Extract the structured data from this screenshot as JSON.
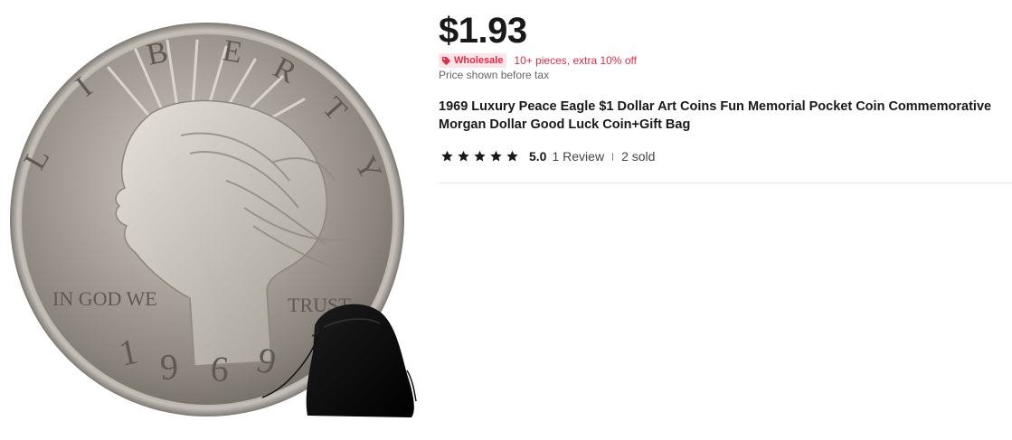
{
  "product": {
    "image": {
      "coin_lettering_top": "LIBERTY",
      "coin_motto_left": "IN GOD WE",
      "coin_motto_right": "TRUST",
      "coin_year": "1969"
    },
    "price": "$1.93",
    "wholesale": {
      "badge_icon": "tag-icon",
      "badge_label": "Wholesale",
      "deal_text": "10+ pieces, extra 10% off"
    },
    "price_note": "Price shown before tax",
    "title": "1969 Luxury Peace Eagle $1 Dollar Art Coins Fun Memorial Pocket Coin Commemorative Morgan Dollar Good Luck Coin+Gift Bag",
    "rating": {
      "stars": 5,
      "value": "5.0",
      "reviews_label": "1 Review",
      "sold_label": "2 sold"
    }
  },
  "colors": {
    "price": "#191919",
    "accent_red": "#e02c47",
    "badge_bg": "#fde4e8",
    "muted": "#666666"
  }
}
